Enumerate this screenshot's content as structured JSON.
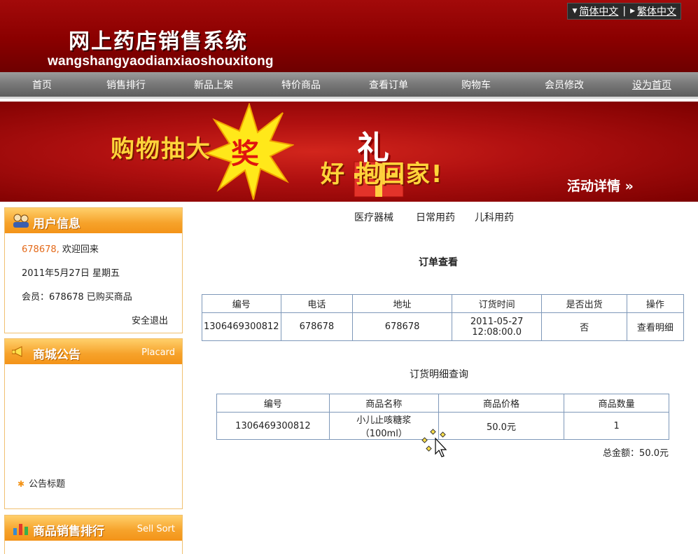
{
  "header": {
    "title": "网上药店销售系统",
    "subtitle": "wangshangyaodianxiaoshouxitong",
    "lang_simplified": "简体中文",
    "lang_traditional": "繁体中文"
  },
  "nav": [
    {
      "label": "首页"
    },
    {
      "label": "销售排行"
    },
    {
      "label": "新品上架"
    },
    {
      "label": "特价商品"
    },
    {
      "label": "查看订单"
    },
    {
      "label": "购物车"
    },
    {
      "label": "会员修改"
    },
    {
      "label": "设为首页"
    }
  ],
  "banner": {
    "text_left": "购物抽大",
    "text_burst": "奖",
    "text_gift": "礼",
    "text_right": "好 抱回家!",
    "detail_link": "活动详情 »"
  },
  "user_info": {
    "header": "用户信息",
    "username": "678678,",
    "welcome": "欢迎回来",
    "date": "2011年5月27日 星期五",
    "member_line": "会员：678678 已购买商品",
    "logout": "安全退出"
  },
  "notice": {
    "header": "商城公告",
    "header_en": "Placard",
    "item_title": "公告标题"
  },
  "sales_rank": {
    "header": "商品销售排行",
    "header_en": "Sell Sort"
  },
  "categories": [
    "医疗器械",
    "日常用药",
    "儿科用药"
  ],
  "order_view": {
    "title": "订单查看",
    "columns": [
      "编号",
      "电话",
      "地址",
      "订货时间",
      "是否出货",
      "操作"
    ],
    "row": {
      "id": "1306469300812",
      "phone": "678678",
      "address": "678678",
      "time_date": "2011-05-27",
      "time_clock": "12:08:00.0",
      "shipped": "否",
      "action": "查看明细"
    }
  },
  "order_detail": {
    "title": "订货明细查询",
    "columns": [
      "编号",
      "商品名称",
      "商品价格",
      "商品数量"
    ],
    "row": {
      "id": "1306469300812",
      "name_line1": "小儿止咳糖浆",
      "name_line2": "（100ml）",
      "price": "50.0元",
      "quantity": "1"
    },
    "total": "总金额：50.0元"
  },
  "colors": {
    "header_red": "#8a0000",
    "nav_gray": "#7a7a7a",
    "sidebar_orange": "#f39318",
    "table_border": "#7e98b9"
  }
}
